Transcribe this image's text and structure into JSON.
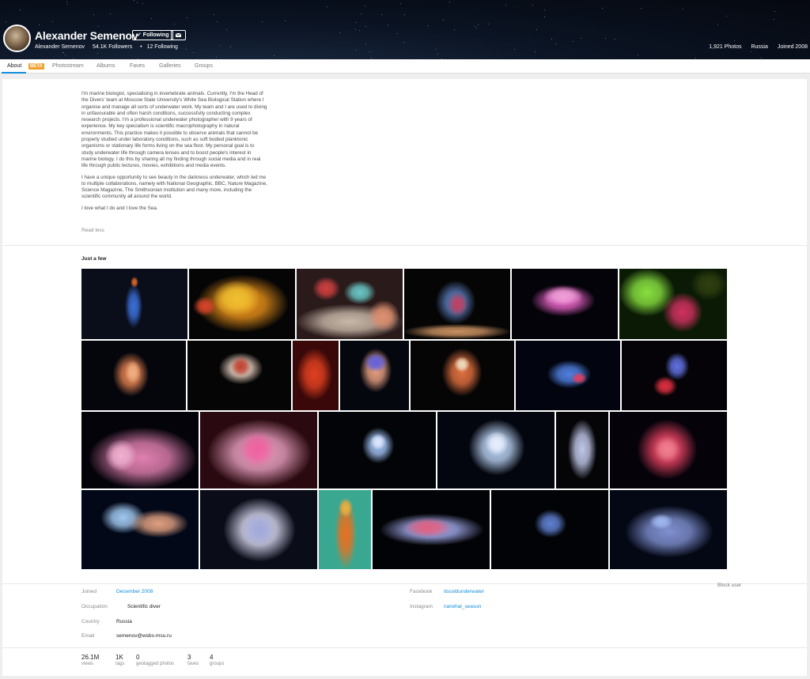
{
  "profile": {
    "name": "Alexander Semenov",
    "following_label": "✓ Following",
    "mail_icon": "mail-icon",
    "username": "Alexander Semenov",
    "followers": "54.1K Followers",
    "following": "12 Following",
    "bullet": "•",
    "photos": "1,921 Photos",
    "country": "Russia",
    "joined": "Joined 2008"
  },
  "tabs": [
    {
      "label": "About"
    },
    {
      "label": "Photostream"
    },
    {
      "label": "Albums"
    },
    {
      "label": "Faves"
    },
    {
      "label": "Galleries"
    },
    {
      "label": "Groups"
    }
  ],
  "beta_badge": "BETA",
  "bio": {
    "p1": "I'm marine biologist, specialising in invertebrate animals. Currently, I'm the Head of the Divers' team at Moscow State University's White Sea Biological Station where I organise and manage all sorts of underwater work. My team and I are used to diving in unfavourable and often harsh conditions, successfully conducting complex research projects. I'm a professional underwater photographer with 9 years of experience. My key specialism is scientific macrophotography in natural environments. This practice makes it possible to observe animals that cannot be properly studied under laboratory conditions, such as soft bodied planktonic organisms or stationary life forms living on the sea floor. My personal goal is to study underwater life through camera lenses and to boost people's interest in marine biology. I do this by sharing all my finding through social media and in real life through public lectures, movies, exhibitions and media events.",
    "p2": "I have a unique opportunity to see beauty in the darkness underwater, which led me to multiple collaborations, namely with National Geographic, BBC, Nature Magazine, Science Magazine, The Smithsonian Institution and many more, including the scientific community all around the world.",
    "p3": "I love what I do and I love the Sea.",
    "read_less": "Read less"
  },
  "showcase_title": "Just a few",
  "info": {
    "joined_label": "Joined",
    "joined_value": "December 2008",
    "occupation_label": "Occupation",
    "occupation_value": "Scientific diver",
    "country_label": "Country",
    "country_value": "Russia",
    "email_label": "Email",
    "email_value": "semenov@wsbs-msu.ru",
    "facebook_label": "Facebook",
    "facebook_value": "itscoldunderwater",
    "instagram_label": "Instagram",
    "instagram_value": "narwhal_season"
  },
  "stats": [
    {
      "num": "26.1M",
      "unit": "views"
    },
    {
      "num": "1K",
      "unit": "tags"
    },
    {
      "num": "0",
      "unit": "geotagged photos"
    },
    {
      "num": "3",
      "unit": "faves"
    },
    {
      "num": "4",
      "unit": "groups"
    }
  ],
  "block_user": "Block user",
  "colors": {
    "accent": "#128fdc",
    "beta": "#f1a128",
    "header_bg": "#0b1424"
  }
}
